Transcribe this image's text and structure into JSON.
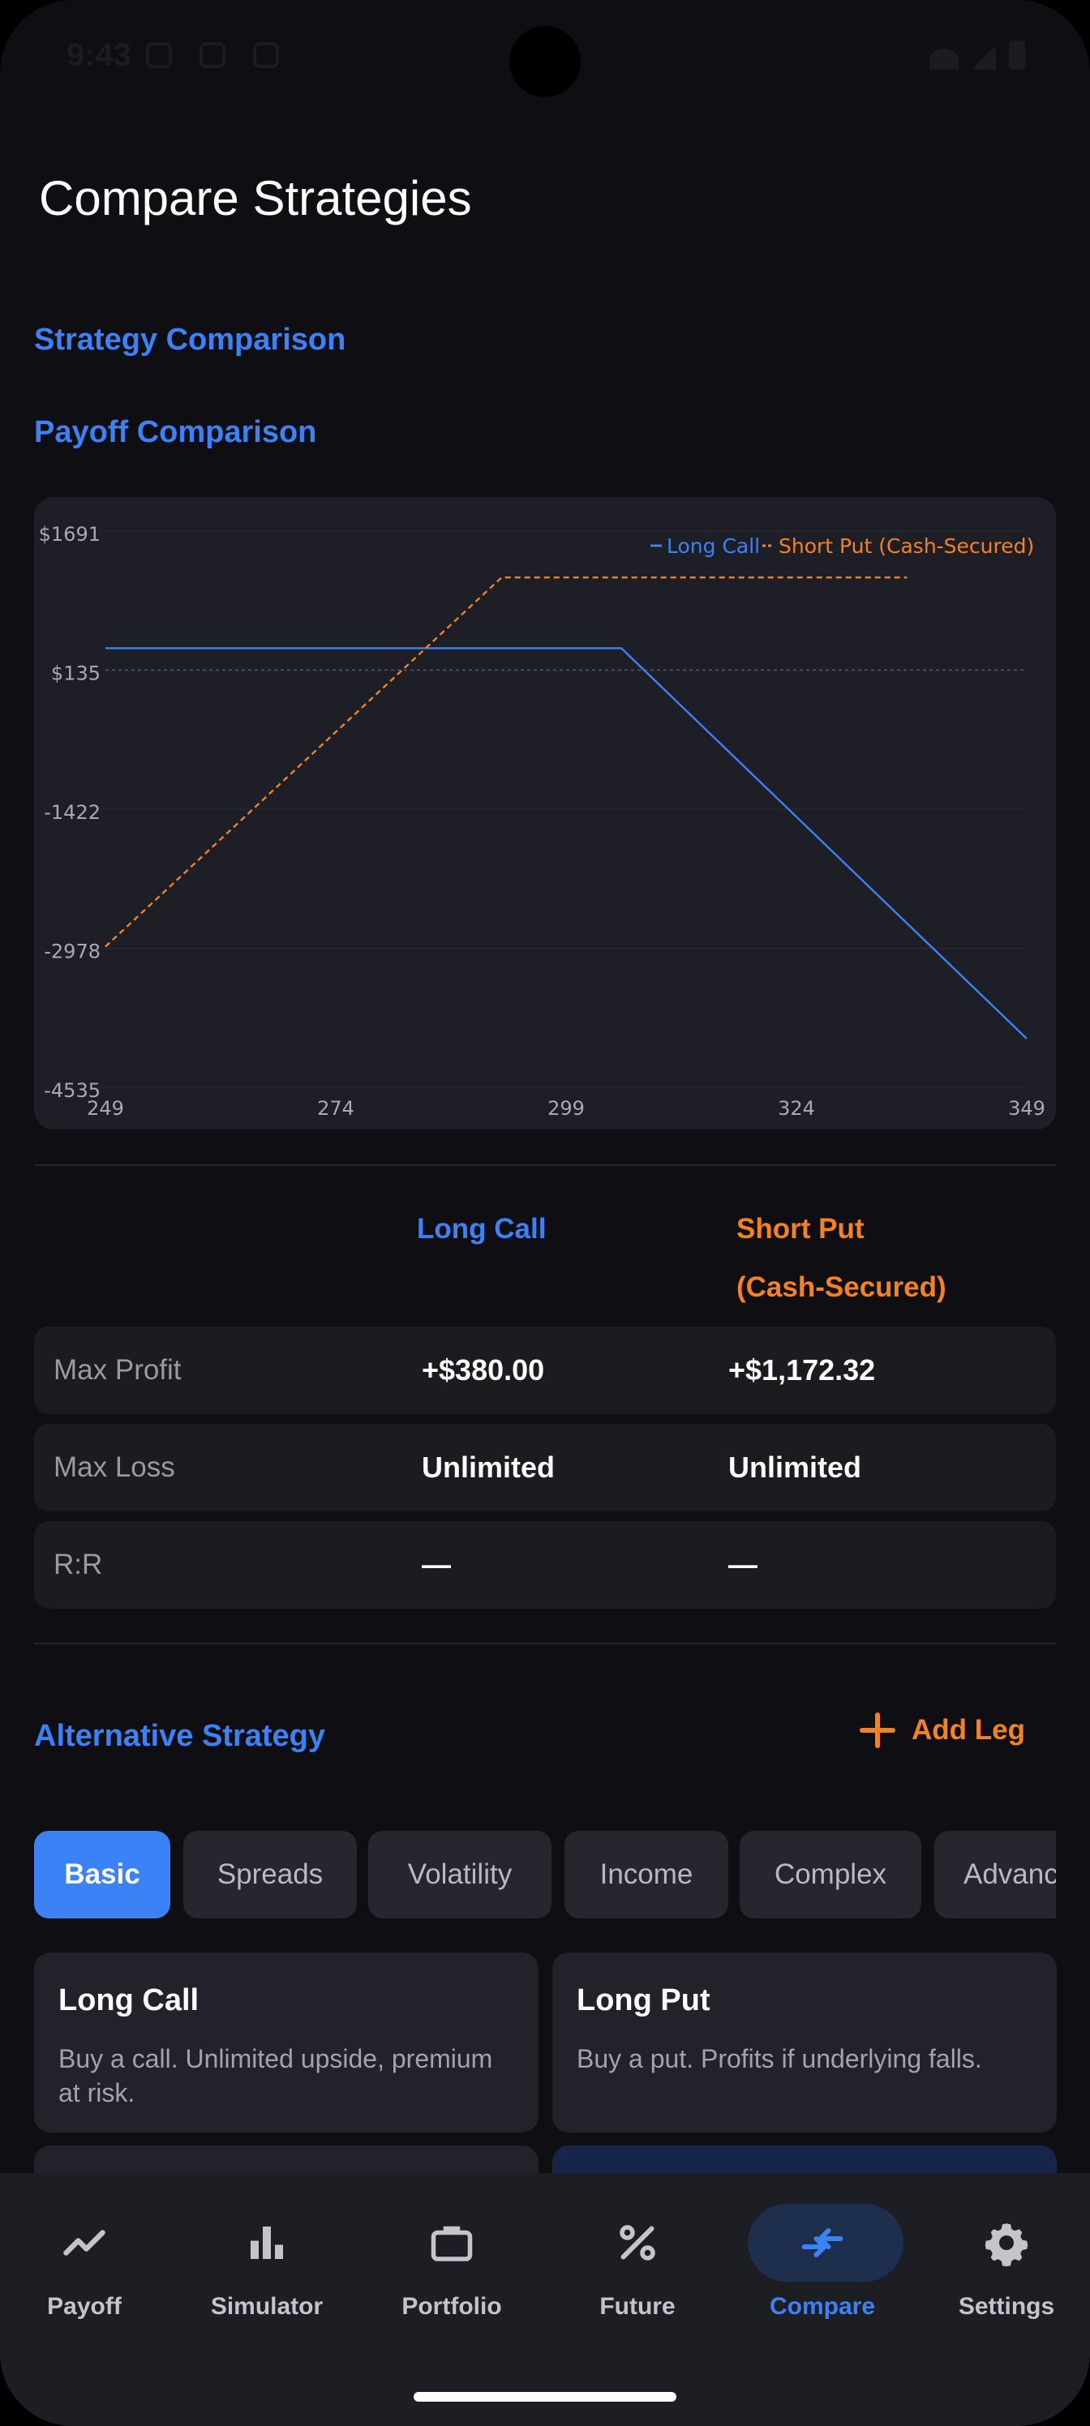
{
  "status_bar": {
    "time": "9:43"
  },
  "page_title": "Compare Strategies",
  "sections": {
    "strategy_comparison": "Strategy Comparison",
    "payoff_comparison": "Payoff Comparison",
    "alternative_strategy": "Alternative Strategy"
  },
  "chart_data": {
    "type": "line",
    "title": "",
    "xlabel": "",
    "ylabel": "",
    "x_ticks": [
      "249",
      "274",
      "299",
      "324",
      "349"
    ],
    "y_ticks": [
      "$1691",
      "$135",
      "-1422",
      "-2978",
      "-4535"
    ],
    "xlim": [
      249,
      349
    ],
    "ylim": [
      -4535,
      1691
    ],
    "zero_line": 135,
    "legend_position": "top-right",
    "series": [
      {
        "name": "Long Call",
        "color": "#3b82f6",
        "style": "solid",
        "x": [
          249,
          305,
          349
        ],
        "y": [
          380,
          380,
          -3990
        ]
      },
      {
        "name": "Short Put (Cash-Secured)",
        "color": "#f58220",
        "style": "dashed",
        "x": [
          249,
          292,
          336
        ],
        "y": [
          -2960,
          1172,
          1172
        ]
      }
    ]
  },
  "comparison": {
    "headers": [
      "Long Call",
      "Short Put",
      "(Cash-Secured)"
    ],
    "rows": [
      {
        "label": "Max Profit",
        "a": "+$380.00",
        "b": "+$1,172.32"
      },
      {
        "label": "Max Loss",
        "a": "Unlimited",
        "b": "Unlimited"
      },
      {
        "label": "R:R",
        "a": "—",
        "b": "—"
      }
    ]
  },
  "add_leg_label": "Add Leg",
  "chips": [
    "Basic",
    "Spreads",
    "Volatility",
    "Income",
    "Complex",
    "Advanced"
  ],
  "active_chip": "Basic",
  "strategy_cards": [
    {
      "title": "Long Call",
      "desc": "Buy a call. Unlimited upside, premium at risk."
    },
    {
      "title": "Long Put",
      "desc": "Buy a put. Profits if underlying falls."
    }
  ],
  "nav": [
    {
      "label": "Payoff",
      "icon": "trend-line-icon"
    },
    {
      "label": "Simulator",
      "icon": "bar-chart-icon"
    },
    {
      "label": "Portfolio",
      "icon": "briefcase-icon"
    },
    {
      "label": "Future",
      "icon": "percent-icon"
    },
    {
      "label": "Compare",
      "icon": "compare-arrows-icon"
    },
    {
      "label": "Settings",
      "icon": "gear-icon"
    }
  ],
  "active_nav": "Compare",
  "colors": {
    "accent": "#3b82f6",
    "orange": "#f58220",
    "background": "#0e0e13",
    "card": "#1e1f26"
  }
}
